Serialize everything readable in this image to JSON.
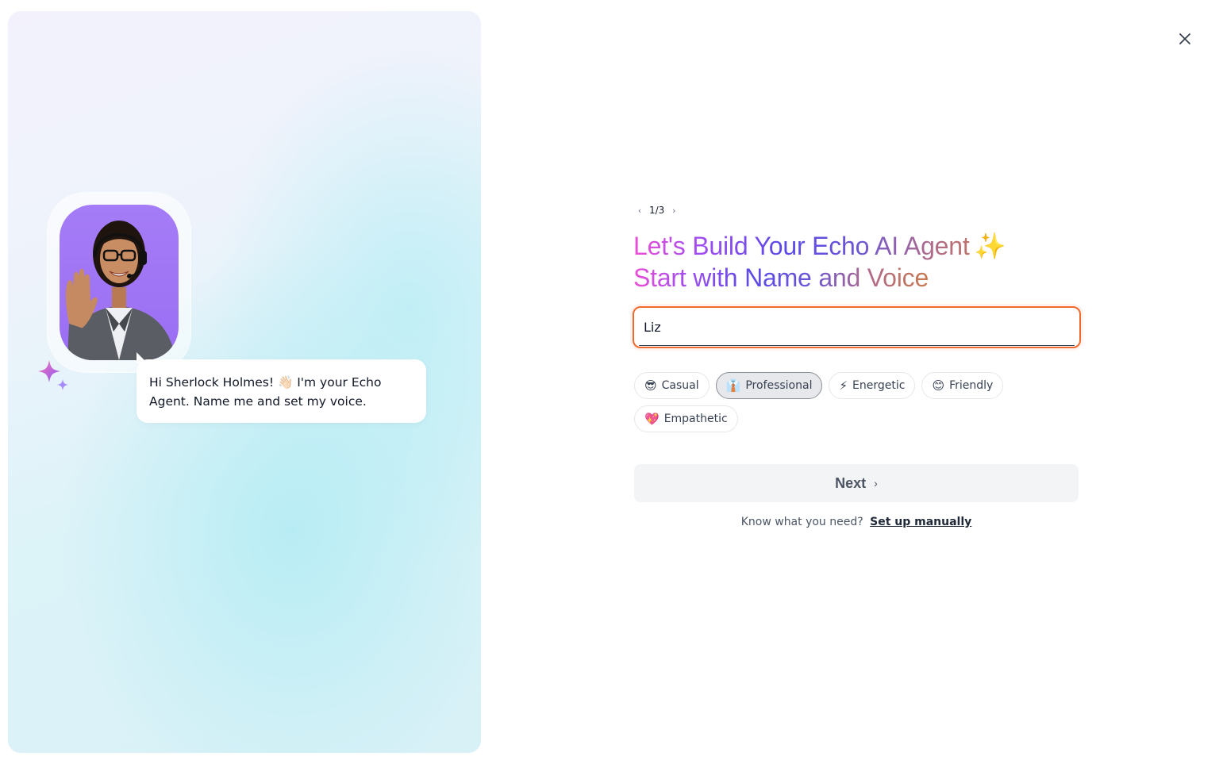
{
  "welcome": {
    "message": "Hi Sherlock Holmes! 👋🏻 I'm your Echo Agent. Name me and set my voice."
  },
  "stepper": {
    "current": "1/3",
    "prev_icon": "chevron-left-icon",
    "next_icon": "chevron-right-icon"
  },
  "title": {
    "line1": "Let's Build Your Echo AI Agent",
    "line1_emoji": "✨",
    "line2": "Start with Name and Voice"
  },
  "name_input": {
    "value": "Liz"
  },
  "tones": [
    {
      "icon": "😎",
      "label": "Casual",
      "selected": false
    },
    {
      "icon": "👔",
      "label": "Professional",
      "selected": true
    },
    {
      "icon": "⚡",
      "label": "Energetic",
      "selected": false
    },
    {
      "icon": "😊",
      "label": "Friendly",
      "selected": false
    },
    {
      "icon": "💖",
      "label": "Empathetic",
      "selected": false
    }
  ],
  "next_button": {
    "label": "Next"
  },
  "manual": {
    "prompt": "Know what you need?",
    "link": "Set up manually"
  },
  "colors": {
    "accent_border": "#f06a2e",
    "avatar_bg": "#9a6ef3",
    "title_gradient": [
      "#ec4fd6",
      "#5b4ae8",
      "#c97a4e"
    ]
  }
}
